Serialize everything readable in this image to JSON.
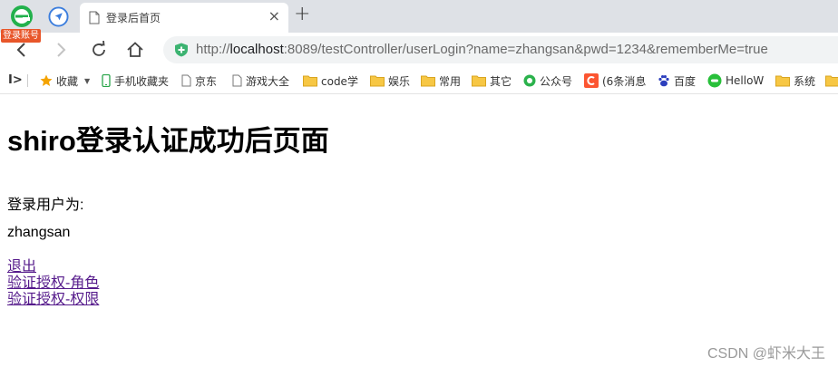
{
  "browser": {
    "extension_label": "登录账号",
    "tab": {
      "title": "登录后首页",
      "close": "×"
    },
    "new_tab": "+",
    "url": {
      "scheme": "http://",
      "host": "localhost",
      "rest": ":8089/testController/userLogin?name=zhangsan&pwd=1234&rememberMe=true"
    },
    "bookmarks": [
      {
        "label": "收藏",
        "icon": "star-icon"
      },
      {
        "label": "手机收藏夹",
        "icon": "phone-icon"
      },
      {
        "label": "京东",
        "icon": "page-icon"
      },
      {
        "label": "游戏大全",
        "icon": "page-icon"
      },
      {
        "label": "code学",
        "icon": "folder-icon"
      },
      {
        "label": "娱乐",
        "icon": "folder-icon"
      },
      {
        "label": "常用",
        "icon": "folder-icon"
      },
      {
        "label": "其它",
        "icon": "folder-icon"
      },
      {
        "label": "公众号",
        "icon": "wechat-icon"
      },
      {
        "label": "(6条消息",
        "icon": "csdn-icon"
      },
      {
        "label": "百度",
        "icon": "baidu-icon"
      },
      {
        "label": "HelloW",
        "icon": "hello-icon"
      },
      {
        "label": "系统",
        "icon": "folder-icon"
      }
    ],
    "colors": {
      "tabstrip": "#dee1e6",
      "secure": "#3cb371",
      "visited_link": "#551a8b",
      "csdn": "#fc5531"
    }
  },
  "page": {
    "title": "shiro登录认证成功后页面",
    "user_label": "登录用户为:",
    "username": "zhangsan",
    "links": [
      "退出",
      "验证授权-角色",
      "验证授权-权限"
    ]
  },
  "watermark": "CSDN @虾米大王"
}
